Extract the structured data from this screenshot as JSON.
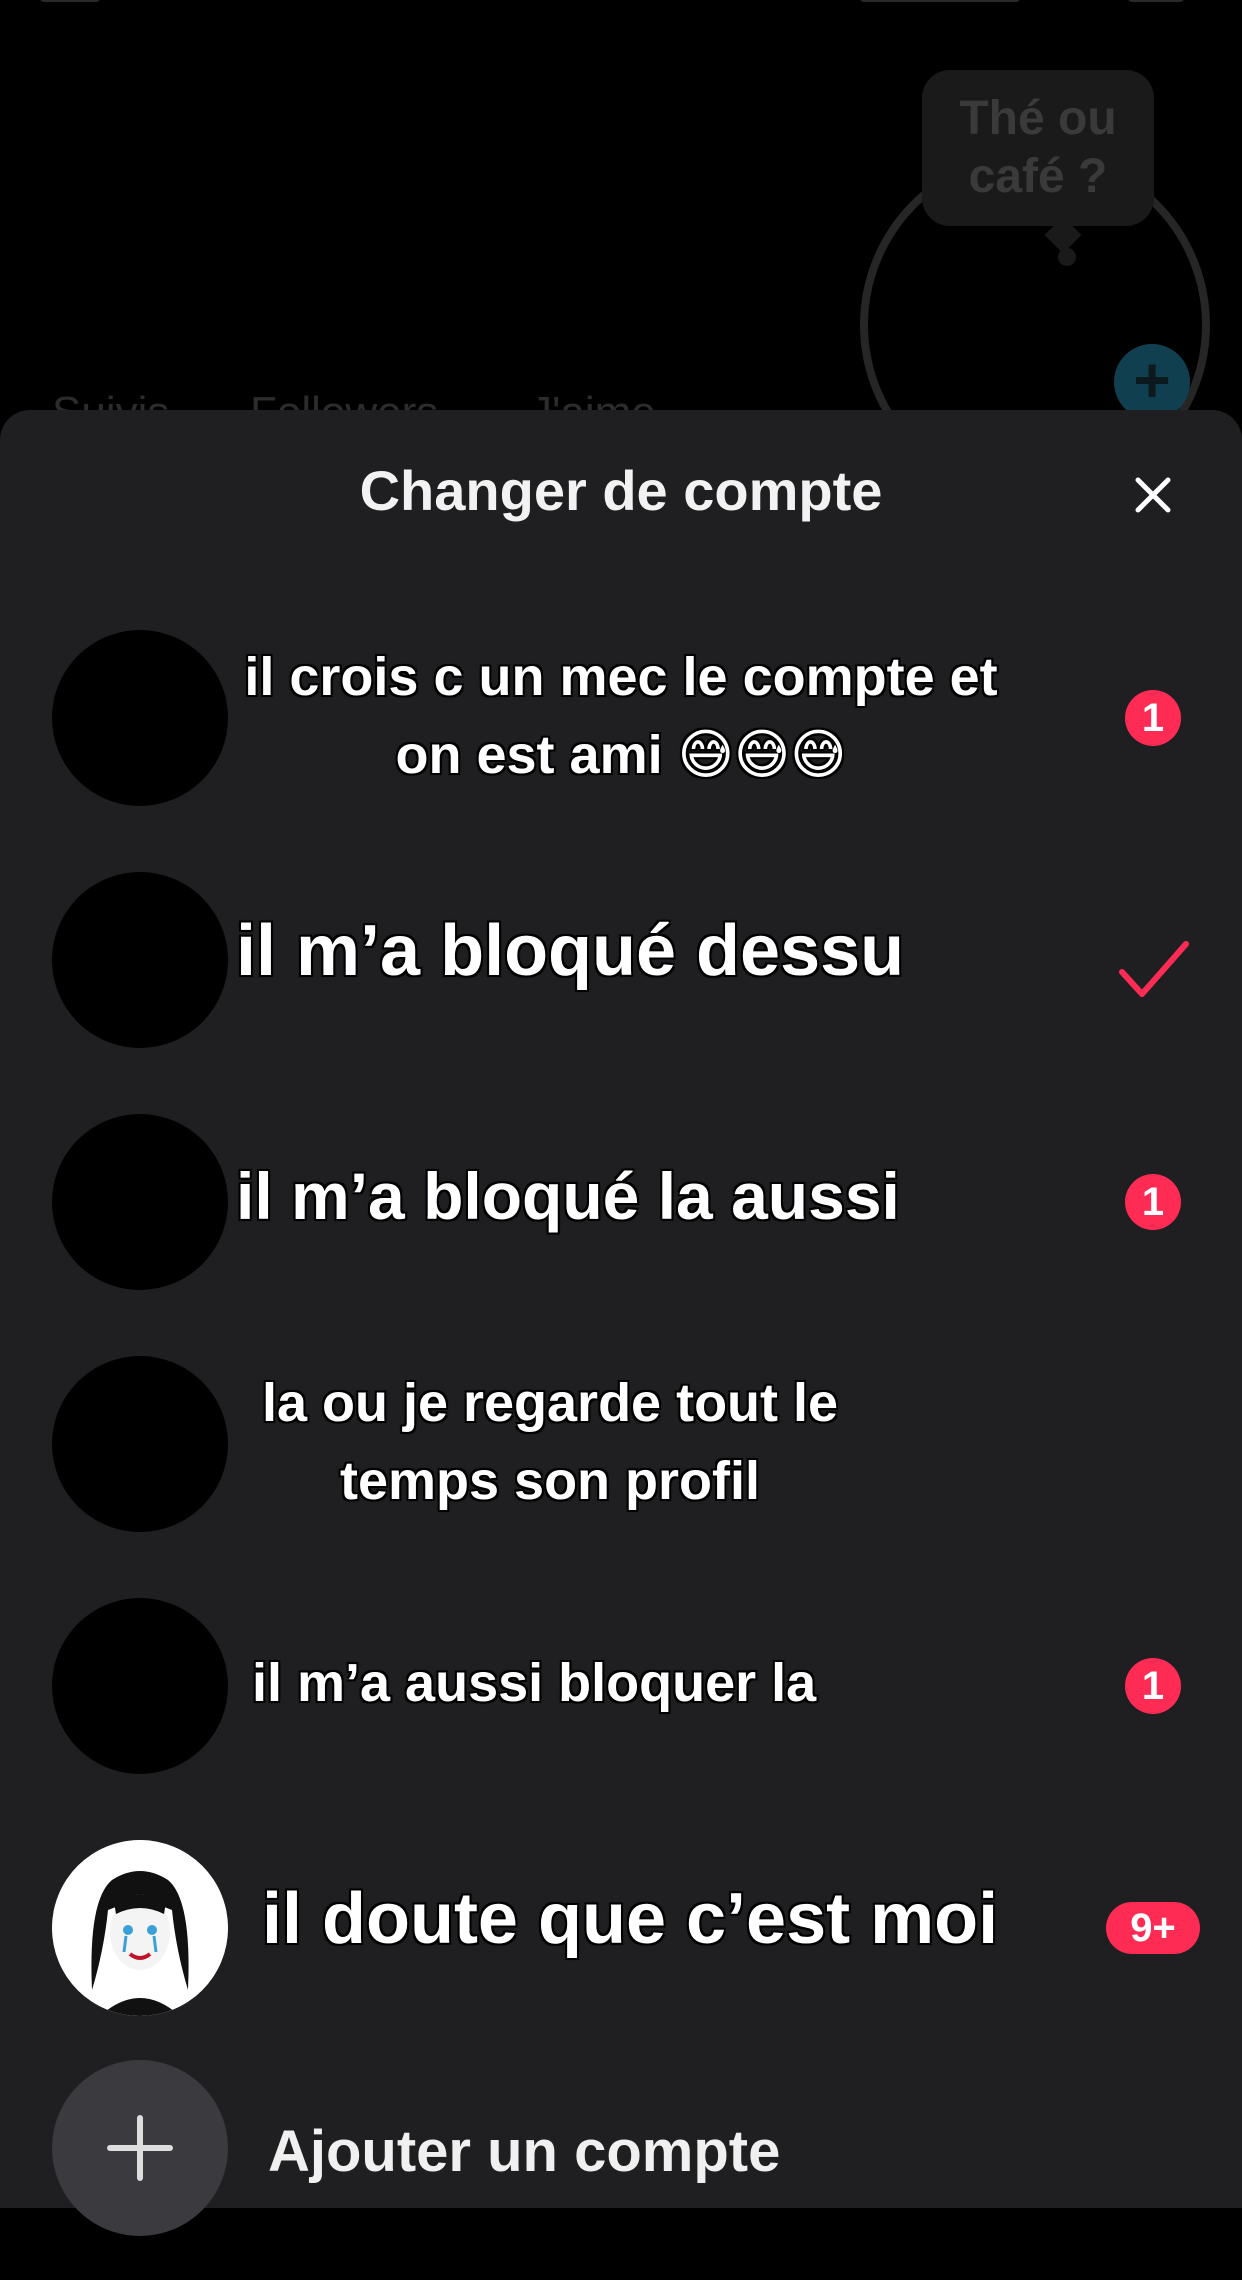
{
  "background": {
    "note_text": "Thé ou café ?",
    "stats": [
      "Suivis",
      "Followers",
      "J'aime"
    ]
  },
  "sheet": {
    "title": "Changer de compte",
    "close_icon": "close-icon",
    "accounts": [
      {
        "name": "il crois c un mec le compte et on est ami 😅😅😅",
        "badge": "1",
        "status": "notification"
      },
      {
        "name": "il m’a bloqué dessu",
        "badge": "",
        "status": "current",
        "check_color": "#fe2c55"
      },
      {
        "name": "il m’a bloqué la aussi",
        "badge": "1",
        "status": "notification"
      },
      {
        "name": "la ou je regarde tout le temps son profil",
        "badge": "",
        "status": "none"
      },
      {
        "name": "il m’a aussi bloquer la",
        "badge": "1",
        "status": "notification"
      },
      {
        "name": "il doute que c’est moi",
        "badge": "9+",
        "status": "notification"
      }
    ],
    "add_account_label": "Ajouter un compte"
  },
  "colors": {
    "sheet_bg": "#1f1e21",
    "badge": "#fe2c55",
    "add_circle": "#3b3a3e"
  }
}
